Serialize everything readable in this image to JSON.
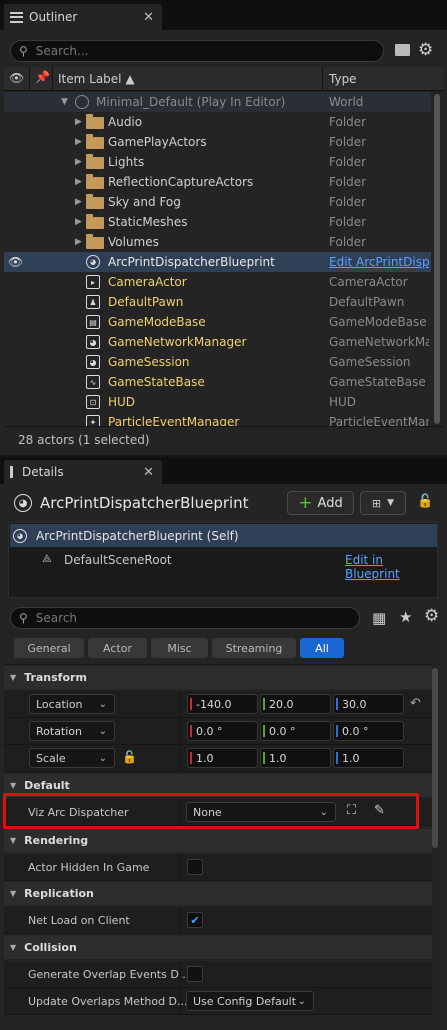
{
  "outliner": {
    "tab_title": "Outliner",
    "search_placeholder": "Search...",
    "col_item_label": "Item Label ▲",
    "col_type": "Type",
    "world": {
      "label": "Minimal_Default (Play In Editor)",
      "type": "World"
    },
    "folders": [
      {
        "label": "Audio",
        "type": "Folder"
      },
      {
        "label": "GamePlayActors",
        "type": "Folder"
      },
      {
        "label": "Lights",
        "type": "Folder"
      },
      {
        "label": "ReflectionCaptureActors",
        "type": "Folder"
      },
      {
        "label": "Sky and Fog",
        "type": "Folder"
      },
      {
        "label": "StaticMeshes",
        "type": "Folder"
      },
      {
        "label": "Volumes",
        "type": "Folder"
      }
    ],
    "actors": [
      {
        "label": "ArcPrintDispatcherBlueprint",
        "type": "Edit ArcPrintDisp"
      },
      {
        "label": "CameraActor",
        "type": "CameraActor"
      },
      {
        "label": "DefaultPawn",
        "type": "DefaultPawn"
      },
      {
        "label": "GameModeBase",
        "type": "GameModeBase"
      },
      {
        "label": "GameNetworkManager",
        "type": "GameNetworkMa"
      },
      {
        "label": "GameSession",
        "type": "GameSession"
      },
      {
        "label": "GameStateBase",
        "type": "GameStateBase"
      },
      {
        "label": "HUD",
        "type": "HUD"
      },
      {
        "label": "ParticleEventManager",
        "type": "ParticleEventMan"
      }
    ],
    "status": "28 actors (1 selected)"
  },
  "details": {
    "tab_title": "Details",
    "actor_name": "ArcPrintDispatcherBlueprint",
    "add_label": "Add",
    "self_component": "ArcPrintDispatcherBlueprint (Self)",
    "root_component": "DefaultSceneRoot",
    "edit_blueprint": "Edit in Blueprint",
    "search_placeholder": "Search",
    "filters": [
      "General",
      "Actor",
      "Misc",
      "Streaming",
      "All"
    ],
    "transform": {
      "section": "Transform",
      "location_label": "Location",
      "rotation_label": "Rotation",
      "scale_label": "Scale",
      "location": [
        "-140.0",
        "20.0",
        "30.0"
      ],
      "rotation": [
        "0.0 °",
        "0.0 °",
        "0.0 °"
      ],
      "scale": [
        "1.0",
        "1.0",
        "1.0"
      ]
    },
    "default_section": "Default",
    "viz_label": "Viz Arc Dispatcher",
    "viz_value": "None",
    "rendering_section": "Rendering",
    "hidden_label": "Actor Hidden In Game",
    "hidden_checked": false,
    "replication_section": "Replication",
    "netload_label": "Net Load on Client",
    "netload_checked": true,
    "collision_section": "Collision",
    "overlap_label": "Generate Overlap Events D...",
    "overlap_checked": false,
    "update_label": "Update Overlaps Method D...",
    "update_value": "Use Config Default"
  },
  "colors": {
    "selected_row": "#2f3f55",
    "link": "#5aa0ff",
    "highlight_box": "#e01010",
    "accent_all": "#1a66d2"
  }
}
